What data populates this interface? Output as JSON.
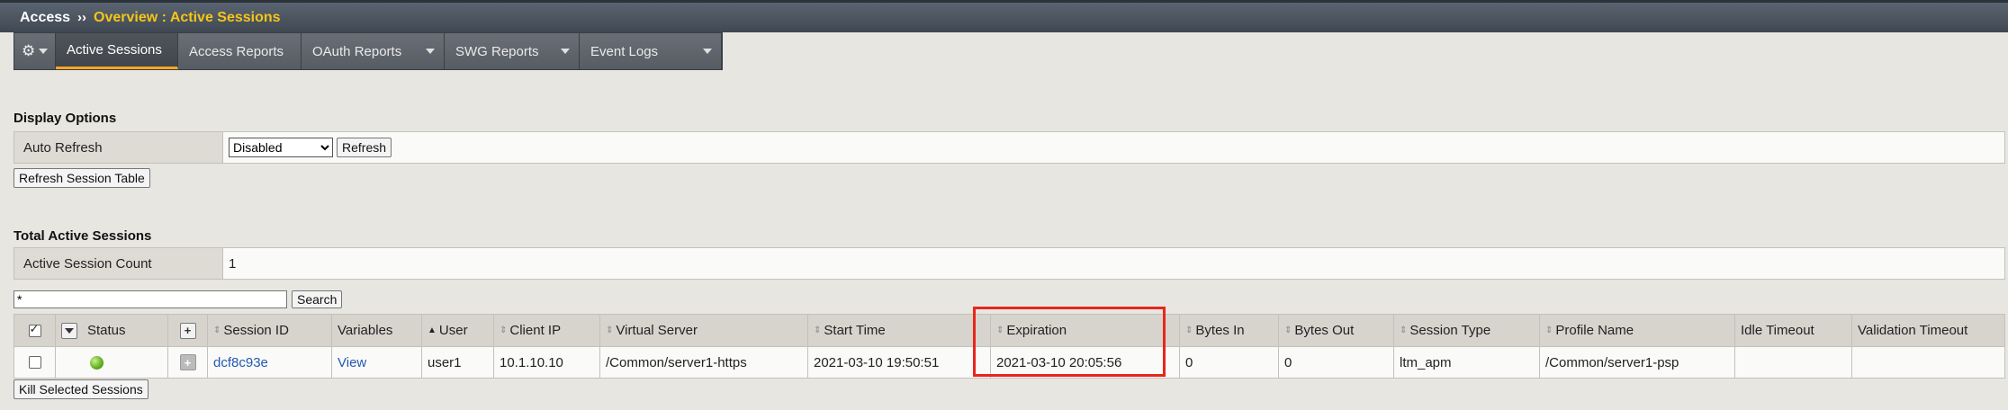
{
  "breadcrumb": {
    "root": "Access",
    "separator": "››",
    "current": "Overview : Active Sessions"
  },
  "tabs": [
    {
      "label": "Active Sessions",
      "active": true,
      "dropdown": false
    },
    {
      "label": "Access Reports",
      "active": false,
      "dropdown": false
    },
    {
      "label": "OAuth Reports",
      "active": false,
      "dropdown": true
    },
    {
      "label": "SWG Reports",
      "active": false,
      "dropdown": true
    },
    {
      "label": "Event Logs",
      "active": false,
      "dropdown": true
    }
  ],
  "display_options": {
    "title": "Display Options",
    "auto_refresh_label": "Auto Refresh",
    "auto_refresh_value": "Disabled",
    "refresh_button": "Refresh",
    "refresh_table_button": "Refresh Session Table"
  },
  "totals": {
    "title": "Total Active Sessions",
    "count_label": "Active Session Count",
    "count_value": "1"
  },
  "search": {
    "value": "*",
    "button": "Search"
  },
  "columns": {
    "status": "Status",
    "session_id": "Session ID",
    "variables": "Variables",
    "user": "User",
    "client_ip": "Client IP",
    "virtual_server": "Virtual Server",
    "start_time": "Start Time",
    "expiration": "Expiration",
    "bytes_in": "Bytes In",
    "bytes_out": "Bytes Out",
    "session_type": "Session Type",
    "profile_name": "Profile Name",
    "idle_timeout": "Idle Timeout",
    "validation_timeout": "Validation Timeout"
  },
  "rows": [
    {
      "status": "green",
      "session_id": "dcf8c93e",
      "variables": "View",
      "user": "user1",
      "client_ip": "10.1.10.10",
      "virtual_server": "/Common/server1-https",
      "start_time": "2021-03-10 19:50:51",
      "expiration": "2021-03-10 20:05:56",
      "bytes_in": "0",
      "bytes_out": "0",
      "session_type": "ltm_apm",
      "profile_name": "/Common/server1-psp",
      "idle_timeout": "",
      "validation_timeout": ""
    }
  ],
  "kill_button": "Kill Selected Sessions",
  "colors": {
    "highlight": "#e8261c",
    "active_tab_underline": "#f5a623",
    "breadcrumb_current": "#f5c518"
  }
}
